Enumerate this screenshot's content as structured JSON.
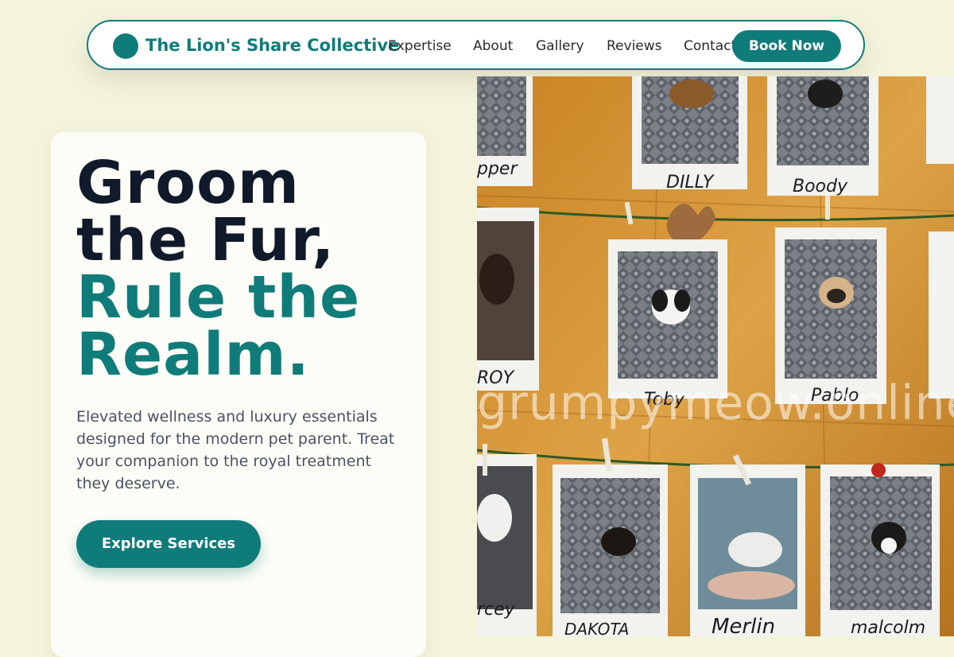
{
  "nav": {
    "brand": "The Lion's Share Collective",
    "links": [
      "Expertise",
      "About",
      "Gallery",
      "Reviews",
      "Contact"
    ],
    "cta": "Book Now"
  },
  "hero": {
    "headline_dark": [
      "Groom",
      "the Fur,"
    ],
    "headline_accent": [
      "Rule the",
      "Realm."
    ],
    "description": "Elevated wellness and luxury essentials designed for the modern pet parent. Treat your companion to the royal treatment they deserve.",
    "cta": "Explore Services"
  },
  "photo": {
    "subject": "instant photos of dogs pinned on a wooden wall",
    "labels": [
      "pper",
      "DILLY",
      "Boody",
      "ROY",
      "Toby",
      "Pablo",
      "rcey",
      "DAKOTA",
      "Merlin",
      "malcolm"
    ],
    "watermark": "grumpymeow.online"
  },
  "colors": {
    "accent": "#0f7c7a",
    "background": "#f4f3dc",
    "headline": "#111a2b",
    "body_text": "#4a5262"
  }
}
